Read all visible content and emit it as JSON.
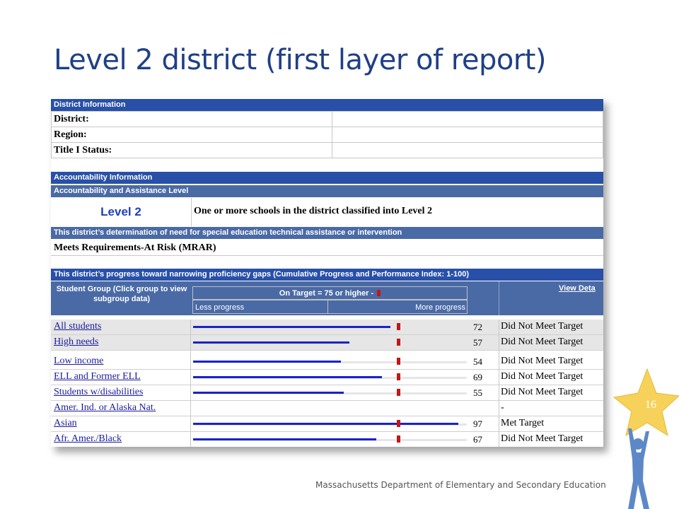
{
  "slide": {
    "title": "Level 2 district (first layer of report)",
    "footer": "Massachusetts Department of Elementary and Secondary Education",
    "page_number": "16",
    "colors": {
      "title": "#1f3f88",
      "header_dark": "#2850a8",
      "header_mid": "#4a6aa6",
      "bar": "#1a23c8",
      "target_marker": "#c01818",
      "star": "#f6d25a",
      "figure": "#5d88c7"
    }
  },
  "district_info": {
    "header": "District Information",
    "labels": [
      "District:",
      "Region:",
      "Title I Status:"
    ]
  },
  "accountability": {
    "header": "Accountability Information",
    "subheader": "Accountability and Assistance Level",
    "level": "Level 2",
    "level_description": "One or more schools in the district classified into Level 2",
    "sped_header": "This district’s determination of need for special education technical assistance or intervention",
    "sped_value": "Meets Requirements-At Risk (MRAR)"
  },
  "progress": {
    "header": "This district’s progress toward narrowing proficiency gaps (Cumulative Progress and Performance Index: 1-100)",
    "col_group": "Student Group (Click group to view subgroup data)",
    "on_target": "On Target = 75 or higher -",
    "less_progress": "Less progress",
    "more_progress": "More progress",
    "view_details": "View Deta",
    "target": 75,
    "rows": [
      {
        "group": "All students",
        "value": "72",
        "result": "Did Not Meet Target",
        "shaded": true
      },
      {
        "group": "High needs",
        "value": "57",
        "result": "Did Not Meet Target",
        "shaded": true
      },
      {
        "group": "Low income",
        "value": "54",
        "result": "Did Not Meet Target",
        "shaded": false
      },
      {
        "group": "ELL and Former ELL",
        "value": "69",
        "result": "Did Not Meet Target",
        "shaded": false
      },
      {
        "group": "Students w/disabilities",
        "value": "55",
        "result": "Did Not Meet Target",
        "shaded": false
      },
      {
        "group": "Amer. Ind. or Alaska Nat.",
        "value": "",
        "result": "-",
        "shaded": false
      },
      {
        "group": "Asian",
        "value": "97",
        "result": "Met Target",
        "shaded": false
      },
      {
        "group": "Afr. Amer./Black",
        "value": "67",
        "result": "Did Not Meet Target",
        "shaded": false
      }
    ]
  }
}
